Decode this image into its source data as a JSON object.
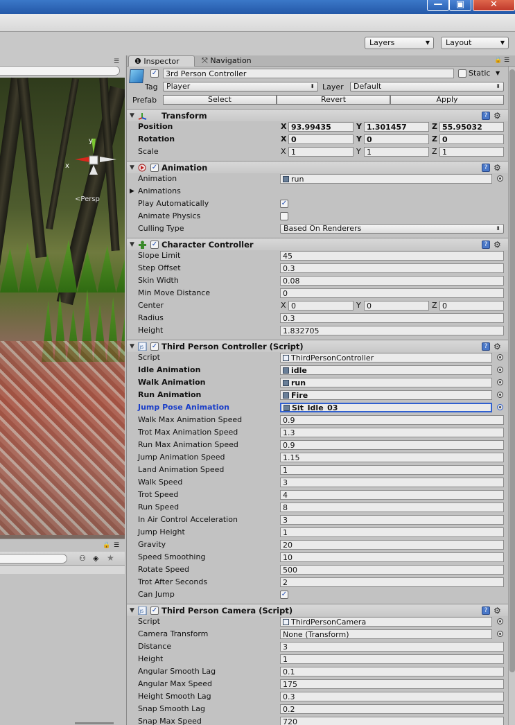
{
  "toolbar": {
    "layers_label": "Layers",
    "layout_label": "Layout"
  },
  "inspector": {
    "tabs": {
      "inspector": "Inspector",
      "navigation": "Navigation"
    },
    "object": {
      "name": "3rd Person Controller",
      "static_label": "Static",
      "tag_label": "Tag",
      "tag_value": "Player",
      "layer_label": "Layer",
      "layer_value": "Default",
      "prefab_label": "Prefab",
      "select": "Select",
      "revert": "Revert",
      "apply": "Apply"
    },
    "transform": {
      "title": "Transform",
      "position_label": "Position",
      "pos_x": "93.99435",
      "pos_y": "1.301457",
      "pos_z": "55.95032",
      "rotation_label": "Rotation",
      "rot_x": "0",
      "rot_y": "0",
      "rot_z": "0",
      "scale_label": "Scale",
      "scale_x": "1",
      "scale_y": "1",
      "scale_z": "1",
      "x": "X",
      "y": "Y",
      "z": "Z"
    },
    "animation": {
      "title": "Animation",
      "animation_label": "Animation",
      "animation_value": "run",
      "animations_label": "Animations",
      "play_auto_label": "Play Automatically",
      "play_auto": true,
      "physics_label": "Animate Physics",
      "physics": false,
      "culling_label": "Culling Type",
      "culling_value": "Based On Renderers"
    },
    "character_controller": {
      "title": "Character Controller",
      "slope_label": "Slope Limit",
      "slope": "45",
      "step_label": "Step Offset",
      "step": "0.3",
      "skin_label": "Skin Width",
      "skin": "0.08",
      "minmove_label": "Min Move Distance",
      "minmove": "0",
      "center_label": "Center",
      "cx": "0",
      "cy": "0",
      "cz": "0",
      "radius_label": "Radius",
      "radius": "0.3",
      "height_label": "Height",
      "height": "1.832705"
    },
    "tpc": {
      "title": "Third Person Controller (Script)",
      "script_label": "Script",
      "script": "ThirdPersonController",
      "idle_label": "Idle Animation",
      "idle": "idle",
      "walk_label": "Walk Animation",
      "walk": "run",
      "run_label": "Run Animation",
      "run": "Fire",
      "jump_label": "Jump Pose Animation",
      "jump": "Sit_Idle_03",
      "walkmax_label": "Walk Max Animation Speed",
      "walkmax": "0.9",
      "trotmax_label": "Trot Max Animation Speed",
      "trotmax": "1.3",
      "runmax_label": "Run Max Animation Speed",
      "runmax": "0.9",
      "jumpspeed_label": "Jump Animation Speed",
      "jumpspeed": "1.15",
      "land_label": "Land Animation Speed",
      "land": "1",
      "walkspeed_label": "Walk Speed",
      "walkspeed": "3",
      "trotspeed_label": "Trot Speed",
      "trotspeed": "4",
      "runspeed_label": "Run Speed",
      "runspeed": "8",
      "inair_label": "In Air Control Acceleration",
      "inair": "3",
      "jumpheight_label": "Jump Height",
      "jumpheight": "1",
      "gravity_label": "Gravity",
      "gravity": "20",
      "smoothing_label": "Speed Smoothing",
      "smoothing": "10",
      "rotate_label": "Rotate Speed",
      "rotate": "500",
      "trotafter_label": "Trot After Seconds",
      "trotafter": "2",
      "canjump_label": "Can Jump",
      "canjump": true
    },
    "tpcam": {
      "title": "Third Person Camera (Script)",
      "script_label": "Script",
      "script": "ThirdPersonCamera",
      "camtrans_label": "Camera Transform",
      "camtrans": "None (Transform)",
      "distance_label": "Distance",
      "distance": "3",
      "height_label": "Height",
      "height": "1",
      "angsmooth_label": "Angular Smooth Lag",
      "angsmooth": "0.1",
      "angmax_label": "Angular Max Speed",
      "angmax": "175",
      "heightsmooth_label": "Height Smooth Lag",
      "heightsmooth": "0.3",
      "snapsmooth_label": "Snap Smooth Lag",
      "snapsmooth": "0.2",
      "snapmax_label": "Snap Max Speed",
      "snapmax": "720"
    }
  },
  "scene": {
    "persp_label": "Persp",
    "gizmo_x": "x",
    "gizmo_y": "y"
  }
}
